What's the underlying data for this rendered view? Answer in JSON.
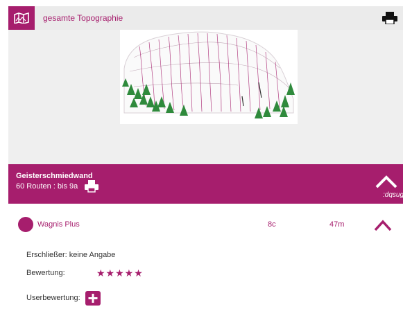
{
  "topbar": {
    "map_icon": "map-icon",
    "label": "gesamte Topographie",
    "print_icon": "printer-icon"
  },
  "sector": {
    "name": "Geisterschmiedwand",
    "info": "60 Routen :  bis  9a",
    "print_icon": "printer-icon",
    "collapse_icon": "chevron-up-icon",
    "note": ":dqsug"
  },
  "route": {
    "name": "Wagnis Plus",
    "grade": "8c",
    "length": "47m",
    "collapse_icon": "chevron-up-icon",
    "color": "#a61e6d"
  },
  "details": {
    "developer_label": "Erschließer:",
    "developer_value": "keine Angabe",
    "rating_label": "Bewertung:",
    "rating_stars": "★★★★★",
    "rating_value": 5,
    "user_rating_label": "Userbewertung:",
    "add_icon": "plus-icon"
  },
  "colors": {
    "accent": "#a61e6d",
    "bar_bg": "#ebebeb",
    "panel_bg": "#efefef"
  }
}
